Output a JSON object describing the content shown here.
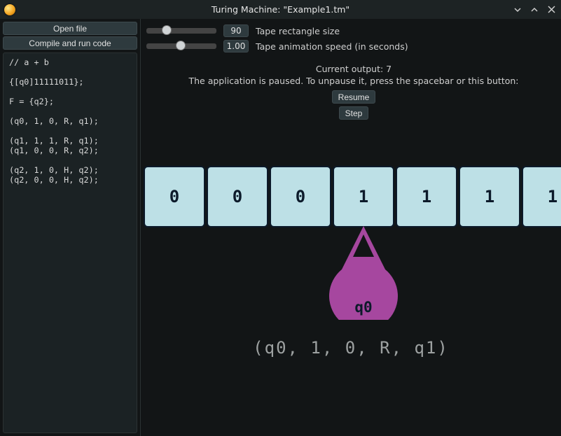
{
  "window": {
    "title": "Turing Machine: \"Example1.tm\""
  },
  "sidebar": {
    "open_file": "Open file",
    "compile_run": "Compile and run code",
    "code": "// a + b\n\n{[q0]11111011};\n\nF = {q2};\n\n(q0, 1, 0, R, q1);\n\n(q1, 1, 1, R, q1);\n(q1, 0, 0, R, q2);\n\n(q2, 1, 0, H, q2);\n(q2, 0, 0, H, q2);"
  },
  "sliders": {
    "rect_size": {
      "value": "90",
      "label": "Tape rectangle size",
      "thumb_pct": 22
    },
    "anim_speed": {
      "value": "1.00",
      "label": "Tape animation speed (in seconds)",
      "thumb_pct": 42
    }
  },
  "status": {
    "output_line": "Current output: 7",
    "paused_line": "The application is paused. To unpause it, press the spacebar or this button:",
    "resume": "Resume",
    "step": "Step"
  },
  "tape": {
    "cells": [
      "0",
      "0",
      "0",
      "1",
      "1",
      "1",
      "1"
    ],
    "head_index": 3,
    "head_state": "q0"
  },
  "transition": "(q0, 1, 0, R, q1)"
}
